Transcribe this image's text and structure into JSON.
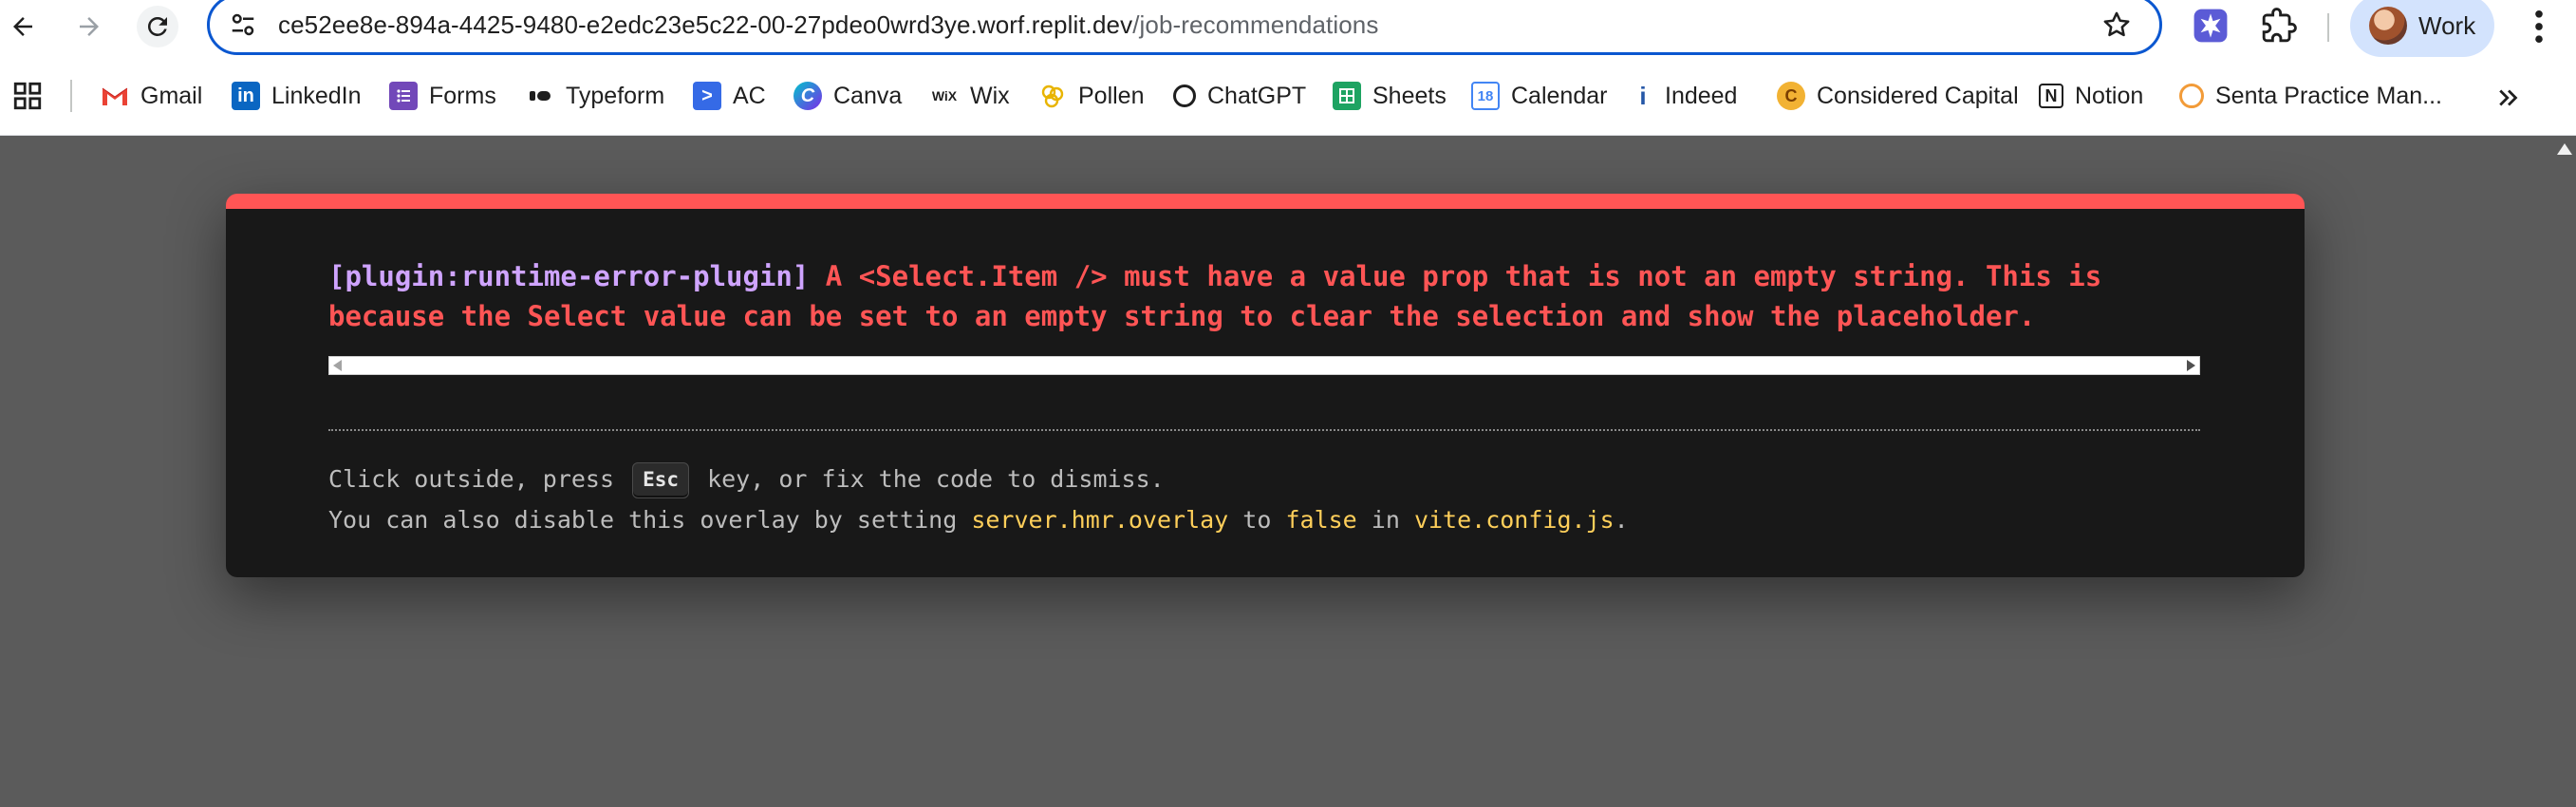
{
  "browser": {
    "url_host": "ce52ee8e-894a-4425-9480-e2edc23e5c22-00-27pdeo0wrd3ye.worf.replit.dev",
    "url_path": "/job-recommendations",
    "profile_name": "Work",
    "accent_color": "#0b57d0"
  },
  "bookmarks": [
    {
      "label": "Gmail",
      "icon": "gmail-icon"
    },
    {
      "label": "LinkedIn",
      "icon": "linkedin-icon"
    },
    {
      "label": "Forms",
      "icon": "forms-icon"
    },
    {
      "label": "Typeform",
      "icon": "typeform-icon"
    },
    {
      "label": "AC",
      "icon": "ac-icon"
    },
    {
      "label": "Canva",
      "icon": "canva-icon"
    },
    {
      "label": "Wix",
      "icon": "wix-icon"
    },
    {
      "label": "Pollen",
      "icon": "pollen-icon"
    },
    {
      "label": "ChatGPT",
      "icon": "chatgpt-icon"
    },
    {
      "label": "Sheets",
      "icon": "sheets-icon"
    },
    {
      "label": "Calendar",
      "icon": "calendar-icon"
    },
    {
      "label": "Indeed",
      "icon": "indeed-icon"
    },
    {
      "label": "Considered Capital",
      "icon": "considered-capital-icon"
    },
    {
      "label": "Notion",
      "icon": "notion-icon"
    },
    {
      "label": "Senta Practice Man...",
      "icon": "senta-icon"
    }
  ],
  "error_overlay": {
    "plugin": "[plugin:runtime-error-plugin]",
    "message": "A <Select.Item /> must have a value prop that is not an empty string. This is\nbecause the Select value can be set to an empty string to clear the selection and show the placeholder.",
    "tip_line1_before": "Click outside, press ",
    "tip_key": "Esc",
    "tip_line1_after": " key, or fix the code to dismiss.",
    "tip_line2_a": "You can also disable this overlay by setting ",
    "tip_line2_code1": "server.hmr.overlay",
    "tip_line2_b": " to ",
    "tip_line2_code2": "false",
    "tip_line2_c": " in ",
    "tip_line2_code3": "vite.config.js",
    "tip_line2_d": ".",
    "accent_color": "#ff5555"
  }
}
